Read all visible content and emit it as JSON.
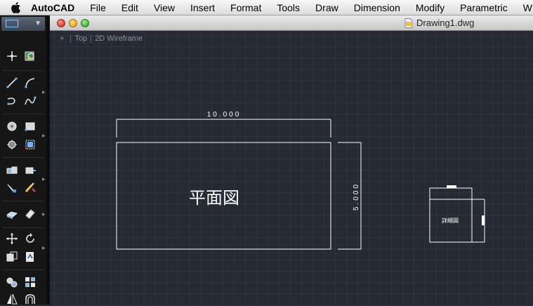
{
  "menubar": {
    "app_name": "AutoCAD",
    "items": [
      "File",
      "Edit",
      "View",
      "Insert",
      "Format",
      "Tools",
      "Draw",
      "Dimension",
      "Modify",
      "Parametric",
      "W"
    ]
  },
  "window": {
    "document_title": "Drawing1.dwg"
  },
  "viewport_controls": {
    "menu": "+",
    "view": "Top",
    "visual_style": "2D Wireframe"
  },
  "drawing": {
    "plan_label": "平面図",
    "detail_label": "詳細図",
    "dim_horizontal": "10.000",
    "dim_vertical": "5.000"
  },
  "toolbar": {
    "icons": [
      "select-window-icon",
      "point-icon",
      "orbit-icon",
      "line-icon",
      "arc-icon",
      "polyline-icon",
      "spline-icon",
      "circle-icon",
      "rectangle-icon",
      "hatch-icon",
      "region-icon",
      "block-icon",
      "insert-block-icon",
      "pencil-icon",
      "match-properties-icon",
      "eraser-icon",
      "move-icon",
      "rotate-icon",
      "copy-icon",
      "text-icon",
      "group-icon",
      "array-icon",
      "mirror-icon",
      "offset-icon"
    ]
  },
  "colors": {
    "canvas": "#262a33",
    "drawing_lines": "#ffffff",
    "panel": "#161616"
  }
}
